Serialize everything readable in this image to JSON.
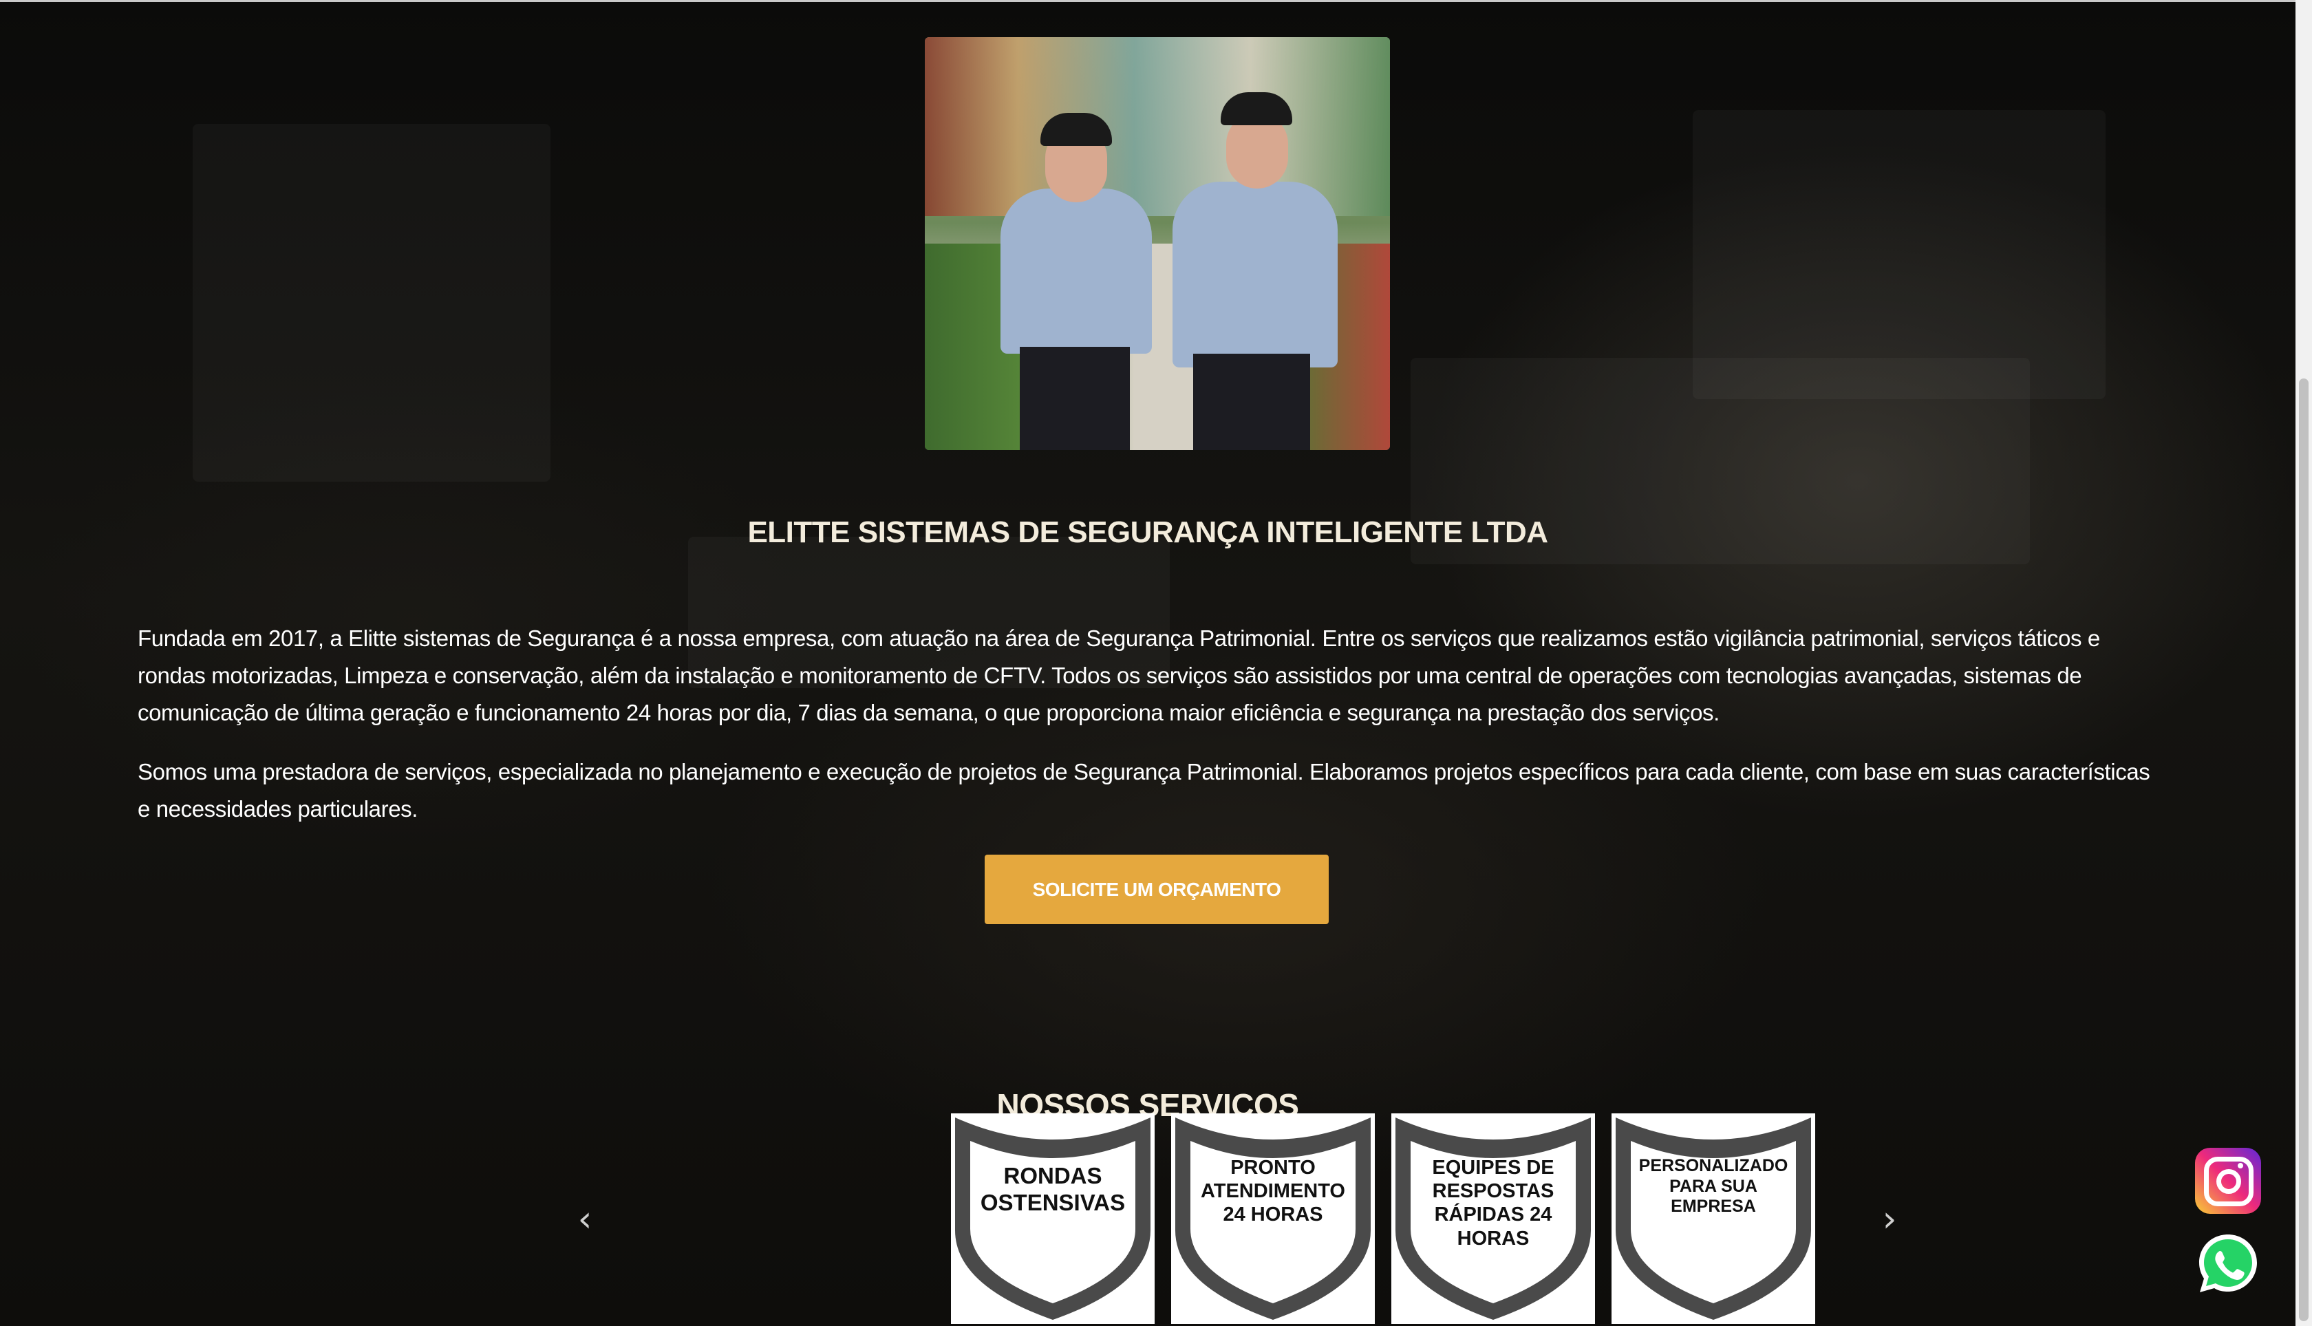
{
  "about": {
    "company_name": "ELITTE SISTEMAS DE SEGURANÇA INTELIGENTE LTDA",
    "paragraph_1": "Fundada em 2017, a Elitte sistemas de Segurança é a nossa empresa, com atuação na área de Segurança Patrimonial. Entre os serviços que realizamos estão vigilância patrimonial, serviços táticos e rondas motorizadas, Limpeza e conservação, além da instalação e monitoramento de CFTV. Todos os serviços são assistidos por uma central de operações com tecnologias avançadas, sistemas de comunicação de última geração e funcionamento 24 horas por dia, 7 dias da semana, o que proporciona maior eficiência e segurança na prestação dos serviços.",
    "paragraph_2": "Somos uma prestadora de serviços, especializada no planejamento e execução de projetos de Segurança Patrimonial. Elaboramos projetos específicos para cada cliente, com base em suas características e necessidades particulares.",
    "cta_label": "SOLICITE UM ORÇAMENTO"
  },
  "services": {
    "title": "NOSSOS SERVIÇOS",
    "prev_icon": "‹",
    "next_icon": "›",
    "cards": [
      {
        "label": "RONDAS OSTENSIVAS"
      },
      {
        "label": "PRONTO ATENDIMENTO 24 HORAS"
      },
      {
        "label": "EQUIPES DE RESPOSTAS RÁPIDAS 24 HORAS"
      },
      {
        "label": "PERSONALIZADO PARA SUA EMPRESA"
      }
    ]
  },
  "colors": {
    "accent": "#e5a83e",
    "heading": "#f3ecdc",
    "shield": "#4a4a4a",
    "whatsapp": "#25d366"
  },
  "icons": {
    "instagram": "instagram-icon",
    "whatsapp": "whatsapp-icon"
  }
}
